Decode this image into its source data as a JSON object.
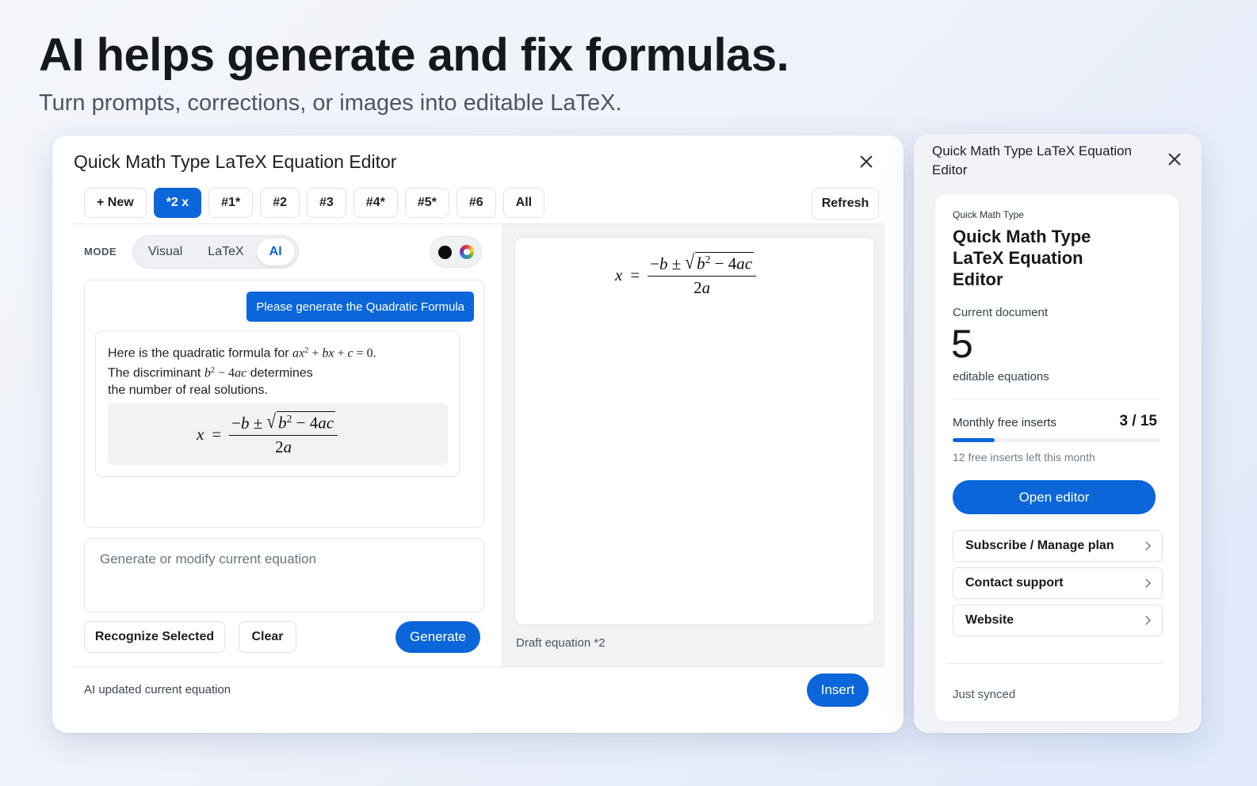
{
  "hero": {
    "title": "AI helps generate and fix formulas.",
    "subtitle": "Turn prompts, corrections, or images into editable LaTeX."
  },
  "dialog": {
    "title": "Quick Math Type LaTeX Equation Editor",
    "tabs": [
      {
        "label": "+ New",
        "active": false
      },
      {
        "label": "*2 x",
        "active": true
      },
      {
        "label": "#1*",
        "active": false
      },
      {
        "label": "#2",
        "active": false
      },
      {
        "label": "#3",
        "active": false
      },
      {
        "label": "#4*",
        "active": false
      },
      {
        "label": "#5*",
        "active": false
      },
      {
        "label": "#6",
        "active": false
      },
      {
        "label": "All",
        "active": false
      }
    ],
    "refresh_label": "Refresh",
    "mode_label": "MODE",
    "modes": [
      "Visual",
      "LaTeX",
      "AI"
    ],
    "active_mode": "AI",
    "color_options": [
      "black",
      "color-wheel"
    ],
    "chat": {
      "user_message": "Please generate the Quadratic Formula",
      "ai_line1_prefix": "Here is the quadratic formula for ",
      "ai_line2_prefix": "The discriminant ",
      "ai_line2_suffix": " determines",
      "ai_line3": "the number of real solutions."
    },
    "prompt_placeholder": "Generate or modify current equation",
    "buttons": {
      "recognize": "Recognize Selected",
      "clear": "Clear",
      "generate": "Generate",
      "insert": "Insert"
    },
    "preview_caption": "Draft equation *2",
    "status": "AI updated current equation"
  },
  "side_panel": {
    "title": "Quick Math Type LaTeX Equation Editor",
    "brand_small": "Quick Math Type",
    "brand_title": "Quick Math Type LaTeX Equation Editor",
    "doc_label": "Current document",
    "doc_count": "5",
    "doc_sub": "editable equations",
    "inserts_label": "Monthly free inserts",
    "inserts_count": "3 / 15",
    "inserts_used": 3,
    "inserts_total": 15,
    "inserts_left": "12 free inserts left this month",
    "open_editor": "Open editor",
    "links": [
      "Subscribe / Manage plan",
      "Contact support",
      "Website"
    ],
    "synced": "Just synced"
  },
  "colors": {
    "accent": "#0a66d9",
    "text": "#1b1f24"
  }
}
